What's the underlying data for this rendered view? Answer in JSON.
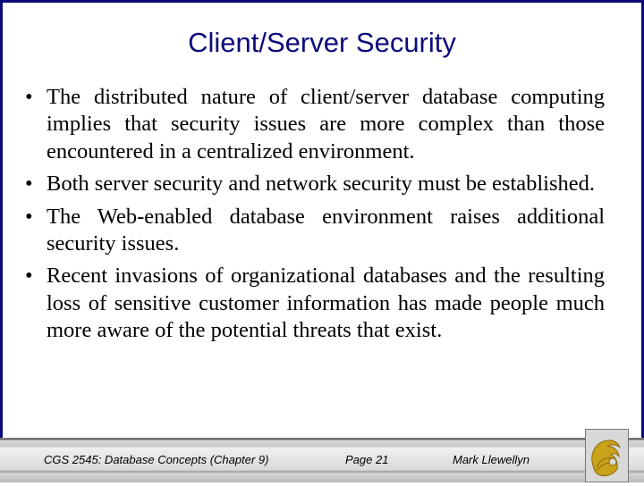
{
  "slide": {
    "title": "Client/Server Security",
    "bullets": [
      "The distributed nature of client/server database computing implies that security issues are more complex than those encountered in a centralized environment.",
      "Both server security and network security must be established.",
      "The Web-enabled database environment raises additional security issues.",
      "Recent invasions of organizational databases and the resulting loss of sensitive customer information has made people much more aware of the potential threats that exist."
    ],
    "bullet_glyph": "•"
  },
  "footer": {
    "course": "CGS 2545: Database Concepts  (Chapter 9)",
    "page": "Page 21",
    "author": "Mark Llewellyn",
    "logo_icon": "pegasus-logo-icon"
  },
  "colors": {
    "title": "#0b0b7a",
    "frame": "#0b0b7a",
    "logo_gold": "#c9a21a"
  }
}
